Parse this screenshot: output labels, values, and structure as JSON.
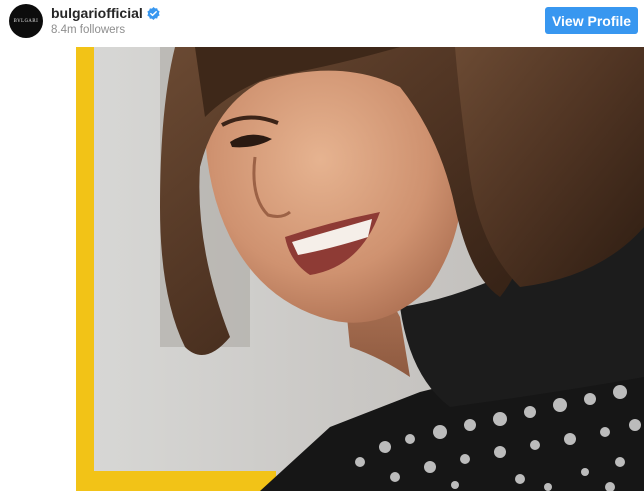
{
  "post": {
    "username": "bulgariofficial",
    "followers": "8.4m followers",
    "view_profile_label": "View Profile",
    "avatar_text": "BVLGARI",
    "verified_icon": "verified-badge-icon"
  },
  "colors": {
    "accent": "#3897f0",
    "frame_yellow": "#f2c317",
    "text_primary": "#262626",
    "text_secondary": "#8e8e8e"
  }
}
